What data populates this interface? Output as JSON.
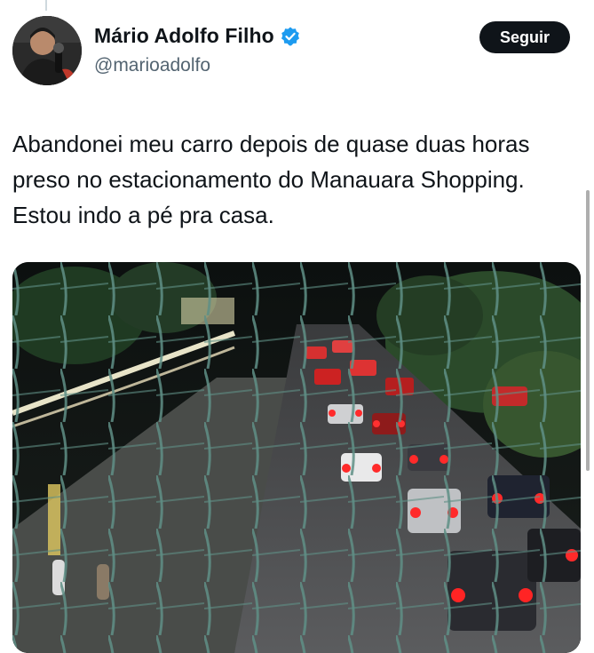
{
  "author": {
    "display_name": "Mário Adolfo Filho",
    "handle": "@marioadolfo",
    "verified": true,
    "avatar_icon": "profile-photo"
  },
  "actions": {
    "follow_label": "Seguir"
  },
  "tweet": {
    "text": "Abandonei meu carro depois de quase duas horas preso no estacionamento do Manauara Shopping. Estou indo a pé pra casa."
  },
  "media": {
    "type": "video-thumbnail",
    "icon": "photo-traffic-jam"
  },
  "colors": {
    "text_primary": "#0f1419",
    "text_secondary": "#536471",
    "verified_blue": "#1d9bf0",
    "button_bg": "#0f1419",
    "button_text": "#ffffff"
  }
}
